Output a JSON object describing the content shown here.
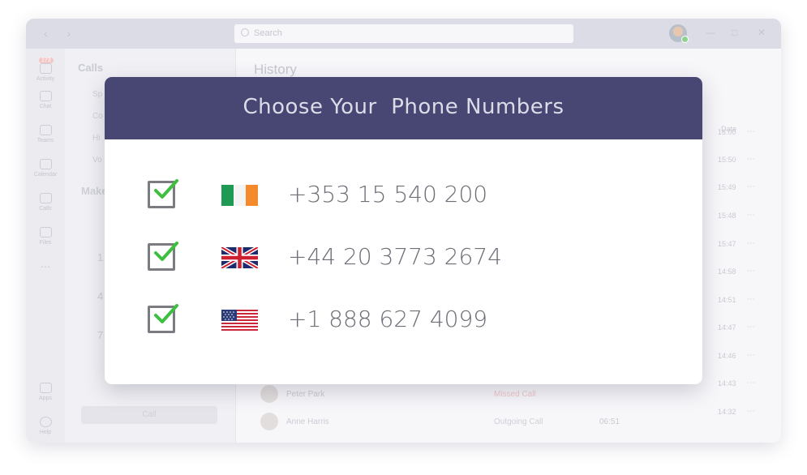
{
  "app": {
    "search_placeholder": "Search",
    "rail": [
      {
        "label": "Activity",
        "badge": "173"
      },
      {
        "label": "Chat"
      },
      {
        "label": "Teams"
      },
      {
        "label": "Calendar"
      },
      {
        "label": "Calls"
      },
      {
        "label": "Files"
      },
      {
        "label": "Apps"
      },
      {
        "label": "Help"
      }
    ],
    "panel_title": "Calls",
    "panel_fragments": [
      "Sp",
      "Co",
      "Hi",
      "Vo",
      "Make",
      "1",
      "4",
      "7"
    ],
    "call_button": "Call",
    "history_title": "History",
    "date_header": "Date",
    "times": [
      "16:00",
      "15:50",
      "15:49",
      "15:48",
      "15:47",
      "14:58",
      "14:51",
      "14:47",
      "14:46",
      "14:43",
      "14:32"
    ],
    "rows": [
      {
        "name": "Peter Park",
        "type": "Missed Call",
        "duration": ""
      },
      {
        "name": "Anne Harris",
        "type": "Outgoing Call",
        "duration": "06:51"
      }
    ]
  },
  "modal": {
    "title": "Choose Your  Phone Numbers",
    "numbers": [
      {
        "flag": "ireland-flag",
        "number": "+353 15 540 200",
        "checked": true
      },
      {
        "flag": "uk-flag",
        "number": "+44 20 3773 2674",
        "checked": true
      },
      {
        "flag": "us-flag",
        "number": "+1 888 627 4099",
        "checked": true
      }
    ]
  },
  "colors": {
    "modal_header": "#484673",
    "check_green": "#3fbf3f",
    "checkbox_border": "#7b7b82",
    "number_text": "#6e6e78"
  }
}
